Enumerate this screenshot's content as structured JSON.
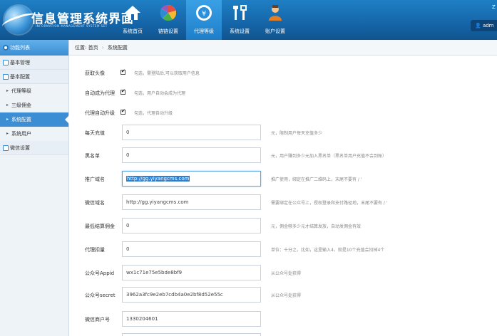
{
  "header": {
    "title": "信息管理系统界面",
    "subtitle": "INFORMATION MANAGEMENT SYSTEM SET",
    "nav": [
      {
        "label": "系统首页",
        "icon": "house-icon"
      },
      {
        "label": "链链设置",
        "icon": "color-wheel-icon"
      },
      {
        "label": "代理等级",
        "icon": "agent-shield-icon"
      },
      {
        "label": "系统设置",
        "icon": "tools-icon"
      },
      {
        "label": "账户设置",
        "icon": "user-icon"
      }
    ],
    "user": "adm",
    "top_hint": "Z"
  },
  "sidebar": {
    "heading": "功能列表",
    "groups": [
      {
        "label": "基本管理"
      },
      {
        "label": "基本配置"
      },
      {
        "label": "微信设置"
      }
    ],
    "sub_items": [
      {
        "label": "代理等级"
      },
      {
        "label": "三级佣金"
      },
      {
        "label": "系统配置"
      },
      {
        "label": "系统用户"
      }
    ]
  },
  "breadcrumb": {
    "prefix": "位置:",
    "home": "首页",
    "current": "系统配置"
  },
  "form": {
    "checkbox_rows": [
      {
        "label": "获取头像",
        "hint": "勾选，需登陆后,可以获取用户信息"
      },
      {
        "label": "自动成为代理",
        "hint": "勾选，用户自动会成为代理"
      },
      {
        "label": "代理自动升级",
        "hint": "勾选，代理自动升级"
      }
    ],
    "input_rows": [
      {
        "label": "每天充值",
        "value": "0",
        "hint": "元，限制用户每天充值多少"
      },
      {
        "label": "黑名单",
        "value": "0",
        "hint": "元，用户赚到多少元加入黑名单（黑名单用户充值不会到账）"
      },
      {
        "label": "推广域名",
        "value": "http://gg.yiyangcms.com",
        "hint": "推广使用，绑定在推广二维码上，末尾不要有  /  '"
      },
      {
        "label": "微信域名",
        "value": "http://gg.yiyangcms.com",
        "hint": "需要绑定在公众号上，授权登录和支付路径地，末尾不要有  /  '"
      },
      {
        "label": "最低结算佣金",
        "value": "0",
        "hint": "元，佣金够多少元才结算发放，自动发佣金有效"
      },
      {
        "label": "代理扣量",
        "value": "0",
        "hint": "单位：十分之，比如，这里输入4，就是10个充值会扣掉4个"
      },
      {
        "label": "公众号Appid",
        "value": "wx1c71e75e5bde8bf9",
        "hint": "从公众号处获得"
      },
      {
        "label": "公众号secret",
        "value": "3962a3fc9e2eb7cdb4a0e2bf8d52e55c",
        "hint": "从公众号处获得"
      },
      {
        "label": "微信商户号",
        "value": "1330204601",
        "hint": ""
      }
    ]
  },
  "colors": {
    "header": "#1565a8",
    "accent": "#3c8ed4",
    "active_nav": "#2b8fdc"
  }
}
